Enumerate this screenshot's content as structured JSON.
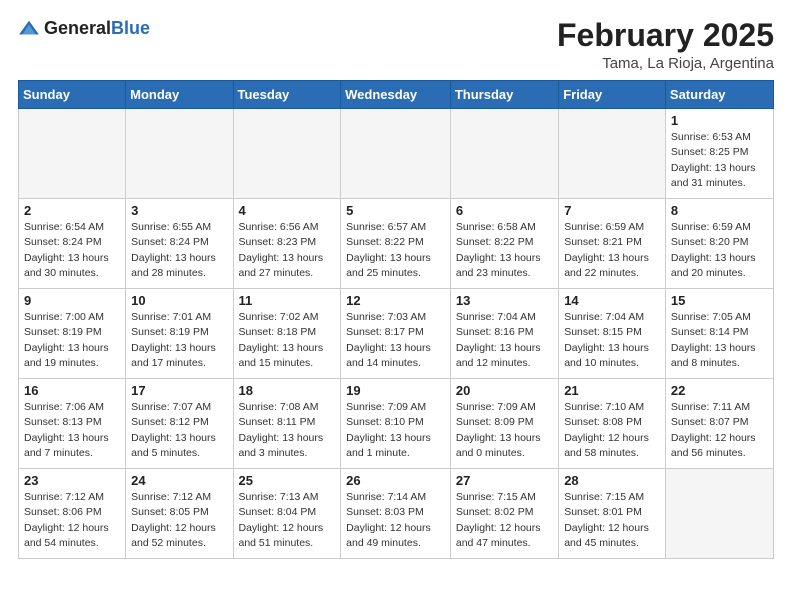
{
  "header": {
    "logo_general": "General",
    "logo_blue": "Blue",
    "month": "February 2025",
    "location": "Tama, La Rioja, Argentina"
  },
  "days_of_week": [
    "Sunday",
    "Monday",
    "Tuesday",
    "Wednesday",
    "Thursday",
    "Friday",
    "Saturday"
  ],
  "weeks": [
    [
      {
        "day": "",
        "info": ""
      },
      {
        "day": "",
        "info": ""
      },
      {
        "day": "",
        "info": ""
      },
      {
        "day": "",
        "info": ""
      },
      {
        "day": "",
        "info": ""
      },
      {
        "day": "",
        "info": ""
      },
      {
        "day": "1",
        "info": "Sunrise: 6:53 AM\nSunset: 8:25 PM\nDaylight: 13 hours\nand 31 minutes."
      }
    ],
    [
      {
        "day": "2",
        "info": "Sunrise: 6:54 AM\nSunset: 8:24 PM\nDaylight: 13 hours\nand 30 minutes."
      },
      {
        "day": "3",
        "info": "Sunrise: 6:55 AM\nSunset: 8:24 PM\nDaylight: 13 hours\nand 28 minutes."
      },
      {
        "day": "4",
        "info": "Sunrise: 6:56 AM\nSunset: 8:23 PM\nDaylight: 13 hours\nand 27 minutes."
      },
      {
        "day": "5",
        "info": "Sunrise: 6:57 AM\nSunset: 8:22 PM\nDaylight: 13 hours\nand 25 minutes."
      },
      {
        "day": "6",
        "info": "Sunrise: 6:58 AM\nSunset: 8:22 PM\nDaylight: 13 hours\nand 23 minutes."
      },
      {
        "day": "7",
        "info": "Sunrise: 6:59 AM\nSunset: 8:21 PM\nDaylight: 13 hours\nand 22 minutes."
      },
      {
        "day": "8",
        "info": "Sunrise: 6:59 AM\nSunset: 8:20 PM\nDaylight: 13 hours\nand 20 minutes."
      }
    ],
    [
      {
        "day": "9",
        "info": "Sunrise: 7:00 AM\nSunset: 8:19 PM\nDaylight: 13 hours\nand 19 minutes."
      },
      {
        "day": "10",
        "info": "Sunrise: 7:01 AM\nSunset: 8:19 PM\nDaylight: 13 hours\nand 17 minutes."
      },
      {
        "day": "11",
        "info": "Sunrise: 7:02 AM\nSunset: 8:18 PM\nDaylight: 13 hours\nand 15 minutes."
      },
      {
        "day": "12",
        "info": "Sunrise: 7:03 AM\nSunset: 8:17 PM\nDaylight: 13 hours\nand 14 minutes."
      },
      {
        "day": "13",
        "info": "Sunrise: 7:04 AM\nSunset: 8:16 PM\nDaylight: 13 hours\nand 12 minutes."
      },
      {
        "day": "14",
        "info": "Sunrise: 7:04 AM\nSunset: 8:15 PM\nDaylight: 13 hours\nand 10 minutes."
      },
      {
        "day": "15",
        "info": "Sunrise: 7:05 AM\nSunset: 8:14 PM\nDaylight: 13 hours\nand 8 minutes."
      }
    ],
    [
      {
        "day": "16",
        "info": "Sunrise: 7:06 AM\nSunset: 8:13 PM\nDaylight: 13 hours\nand 7 minutes."
      },
      {
        "day": "17",
        "info": "Sunrise: 7:07 AM\nSunset: 8:12 PM\nDaylight: 13 hours\nand 5 minutes."
      },
      {
        "day": "18",
        "info": "Sunrise: 7:08 AM\nSunset: 8:11 PM\nDaylight: 13 hours\nand 3 minutes."
      },
      {
        "day": "19",
        "info": "Sunrise: 7:09 AM\nSunset: 8:10 PM\nDaylight: 13 hours\nand 1 minute."
      },
      {
        "day": "20",
        "info": "Sunrise: 7:09 AM\nSunset: 8:09 PM\nDaylight: 13 hours\nand 0 minutes."
      },
      {
        "day": "21",
        "info": "Sunrise: 7:10 AM\nSunset: 8:08 PM\nDaylight: 12 hours\nand 58 minutes."
      },
      {
        "day": "22",
        "info": "Sunrise: 7:11 AM\nSunset: 8:07 PM\nDaylight: 12 hours\nand 56 minutes."
      }
    ],
    [
      {
        "day": "23",
        "info": "Sunrise: 7:12 AM\nSunset: 8:06 PM\nDaylight: 12 hours\nand 54 minutes."
      },
      {
        "day": "24",
        "info": "Sunrise: 7:12 AM\nSunset: 8:05 PM\nDaylight: 12 hours\nand 52 minutes."
      },
      {
        "day": "25",
        "info": "Sunrise: 7:13 AM\nSunset: 8:04 PM\nDaylight: 12 hours\nand 51 minutes."
      },
      {
        "day": "26",
        "info": "Sunrise: 7:14 AM\nSunset: 8:03 PM\nDaylight: 12 hours\nand 49 minutes."
      },
      {
        "day": "27",
        "info": "Sunrise: 7:15 AM\nSunset: 8:02 PM\nDaylight: 12 hours\nand 47 minutes."
      },
      {
        "day": "28",
        "info": "Sunrise: 7:15 AM\nSunset: 8:01 PM\nDaylight: 12 hours\nand 45 minutes."
      },
      {
        "day": "",
        "info": ""
      }
    ]
  ]
}
